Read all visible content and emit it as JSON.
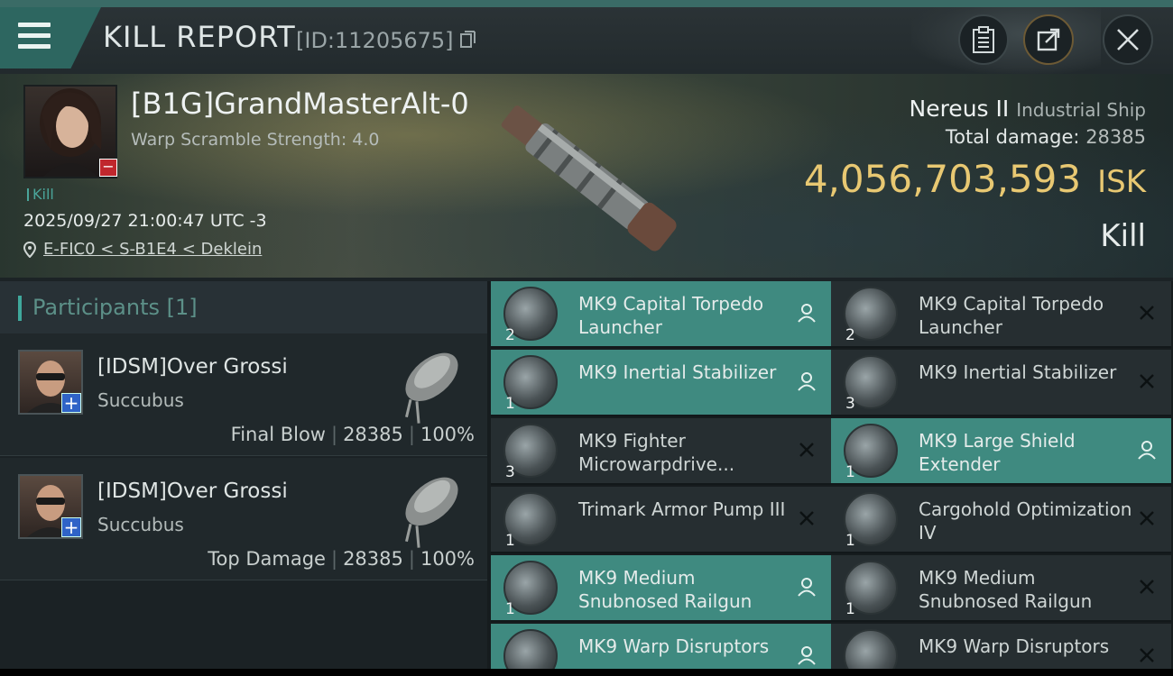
{
  "header": {
    "title": "KILL REPORT",
    "report_id": "[ID:11205675]",
    "icons": {
      "menu": "menu-icon",
      "copy": "copy-icon",
      "clipboard": "clipboard-icon",
      "share": "share-icon",
      "close": "close-icon"
    }
  },
  "victim": {
    "name": "[B1G]GrandMasterAlt-0",
    "warp_scramble": "Warp Scramble Strength: 4.0",
    "tag": "Kill",
    "datetime": "2025/09/27 21:00:47 UTC -3",
    "location": "E-FIC0 < S-B1E4 < Deklein",
    "ship_name": "Nereus II",
    "ship_class": "Industrial Ship",
    "total_damage_label": "Total damage:",
    "total_damage": "28385",
    "isk_value": "4,056,703,593",
    "isk_unit": "ISK",
    "result": "Kill"
  },
  "participants": {
    "title": "Participants [1]",
    "rows": [
      {
        "name": "[IDSM]Over Grossi",
        "ship": "Succubus",
        "role": "Final Blow",
        "damage": "28385",
        "percent": "100%"
      },
      {
        "name": "[IDSM]Over Grossi",
        "ship": "Succubus",
        "role": "Top Damage",
        "damage": "28385",
        "percent": "100%"
      }
    ]
  },
  "modules": [
    {
      "qty": "2",
      "name": "MK9 Capital Torpedo Launcher",
      "state": "fitted"
    },
    {
      "qty": "2",
      "name": "MK9 Capital Torpedo Launcher",
      "state": "destroyed"
    },
    {
      "qty": "1",
      "name": "MK9 Inertial Stabilizer",
      "state": "fitted"
    },
    {
      "qty": "3",
      "name": "MK9 Inertial Stabilizer",
      "state": "destroyed"
    },
    {
      "qty": "3",
      "name": "MK9 Fighter Microwarpdrive...",
      "state": "destroyed"
    },
    {
      "qty": "1",
      "name": "MK9 Large Shield Extender",
      "state": "fitted"
    },
    {
      "qty": "1",
      "name": "Trimark Armor Pump III",
      "state": "destroyed"
    },
    {
      "qty": "1",
      "name": "Cargohold Optimization IV",
      "state": "destroyed"
    },
    {
      "qty": "1",
      "name": "MK9 Medium Snubnosed Railgun",
      "state": "fitted"
    },
    {
      "qty": "1",
      "name": "MK9 Medium Snubnosed Railgun",
      "state": "destroyed"
    },
    {
      "qty": "",
      "name": "MK9 Warp Disruptors",
      "state": "fitted"
    },
    {
      "qty": "",
      "name": "MK9 Warp Disruptors",
      "state": "destroyed"
    }
  ],
  "colors": {
    "accent": "#3f8a80",
    "isk": "#e8c872",
    "badge_red": "#c0272d",
    "badge_blue": "#2f63c7"
  }
}
